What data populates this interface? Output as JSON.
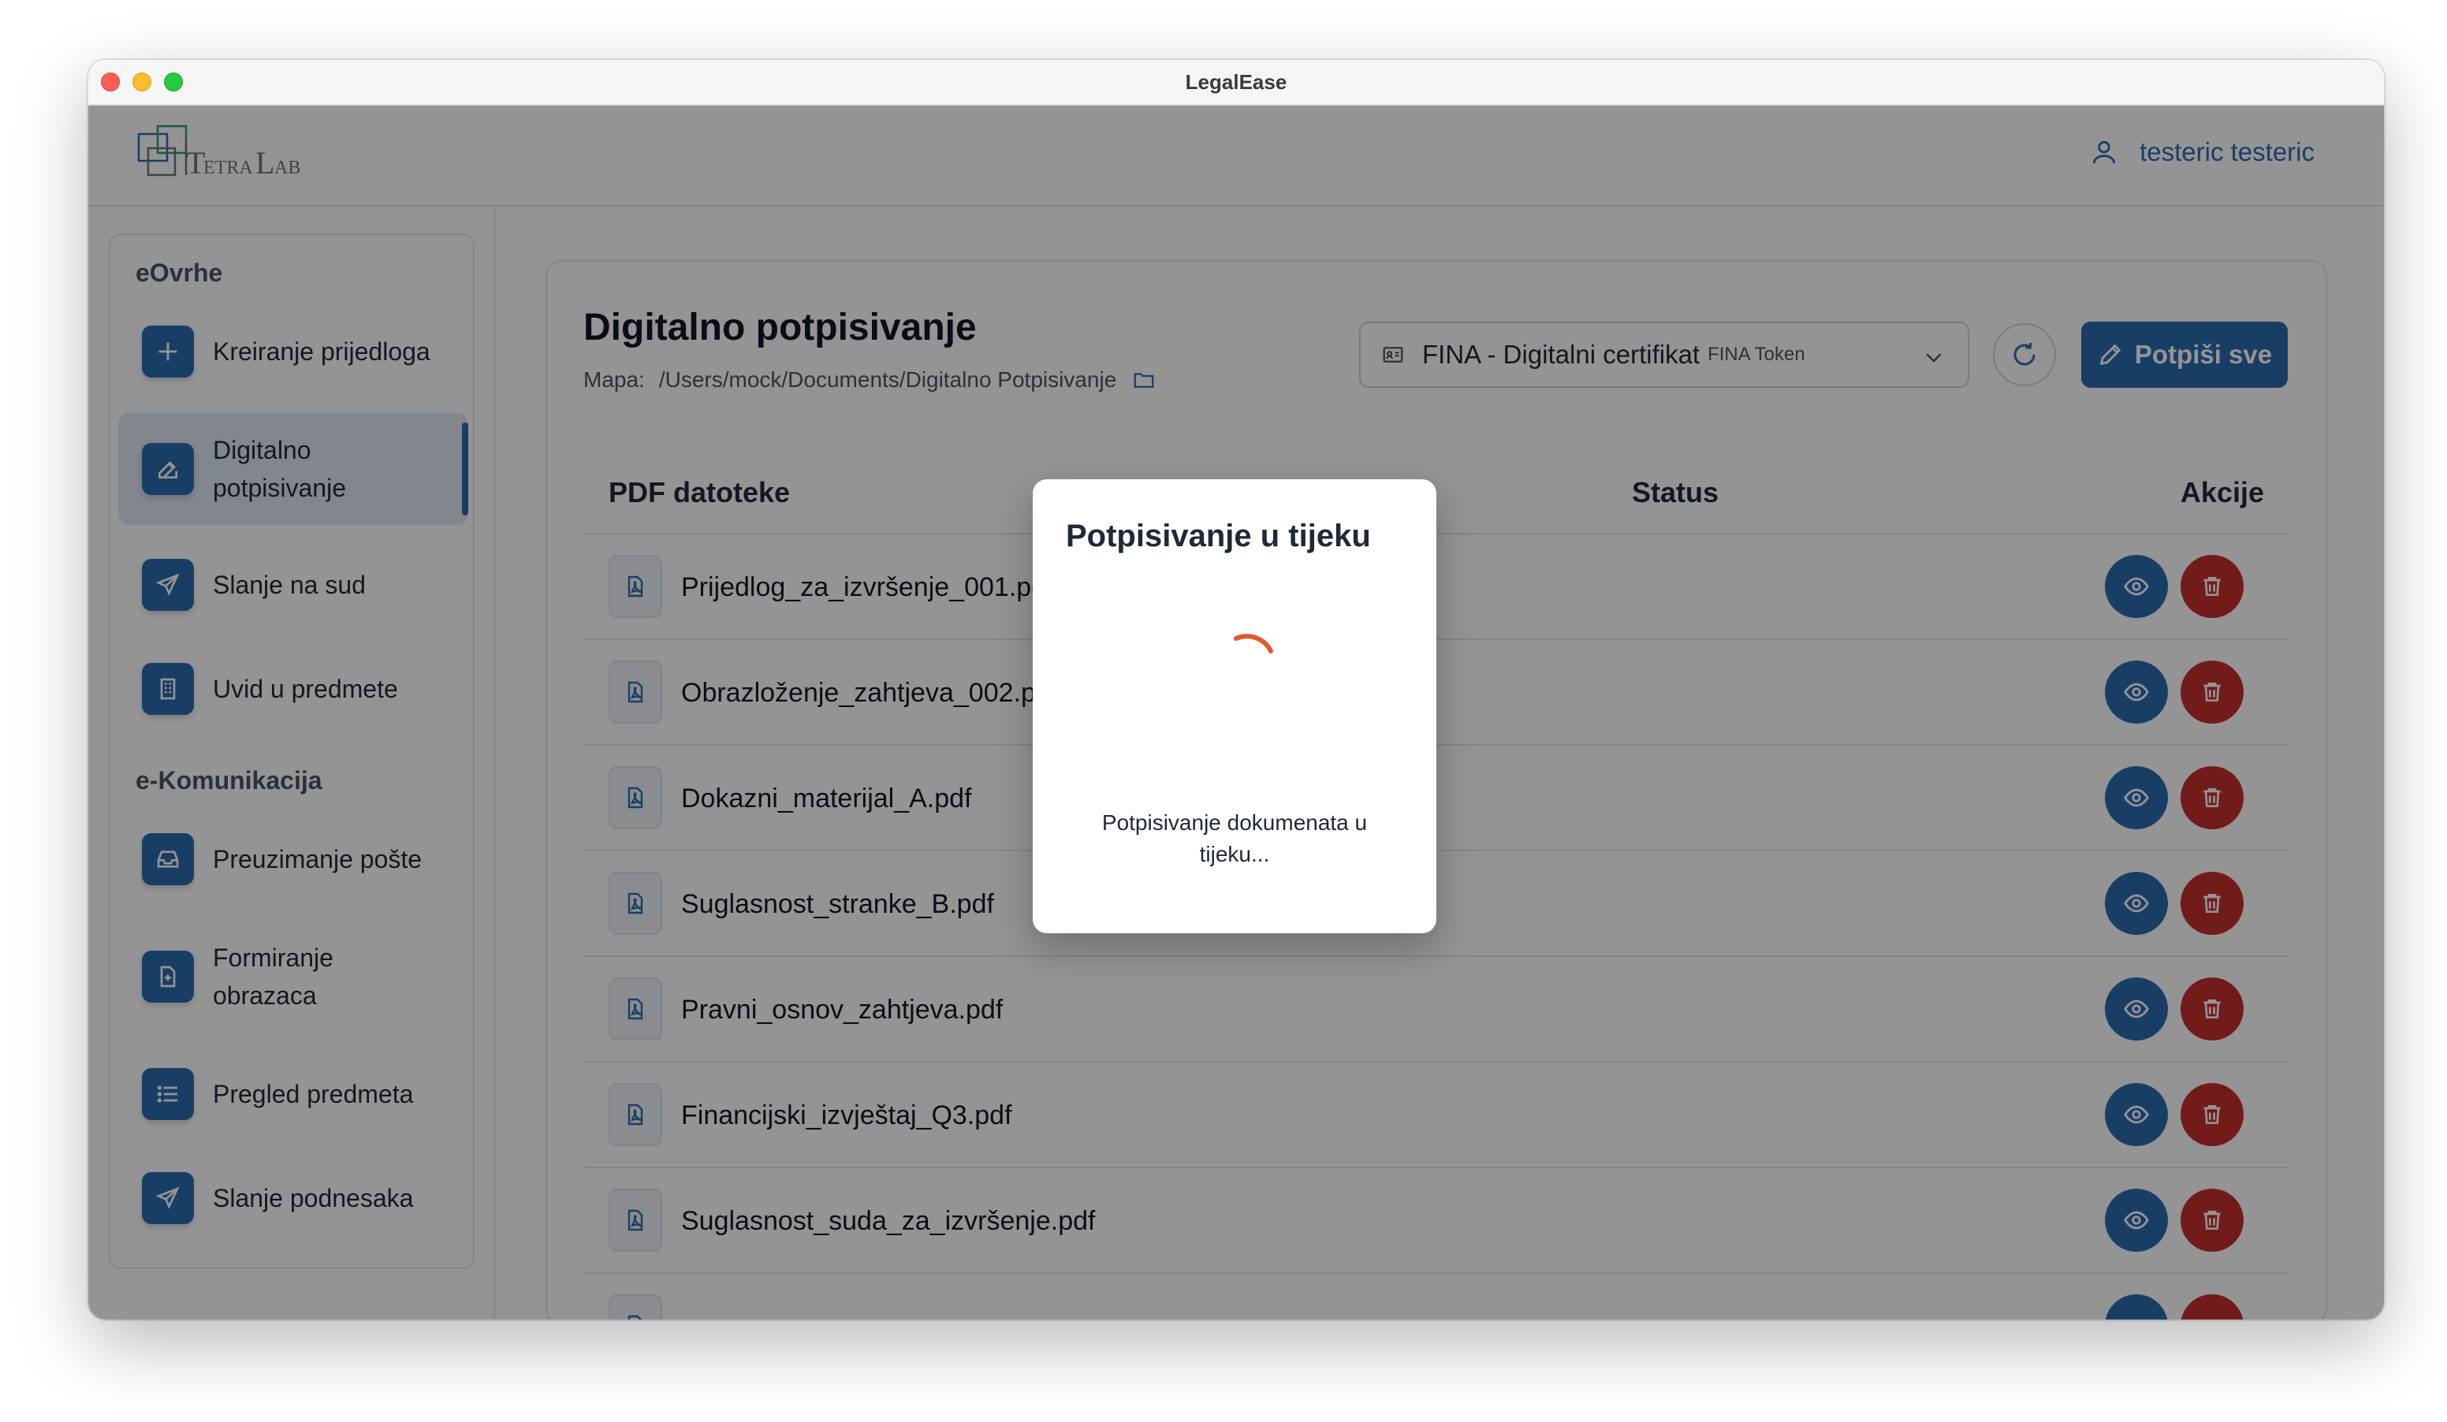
{
  "window": {
    "title": "LegalEase"
  },
  "header": {
    "logo_text": "TetraLab",
    "user_name": "testeric testeric"
  },
  "sidebar": {
    "sections": [
      {
        "title": "eOvrhe"
      },
      {
        "title": "e-Komunikacija"
      }
    ],
    "items": [
      {
        "label": "Kreiranje prijedloga",
        "icon": "plus-icon",
        "active": false
      },
      {
        "label": "Digitalno\npotpisivanje",
        "icon": "edit-icon",
        "active": true
      },
      {
        "label": "Slanje na sud",
        "icon": "send-icon",
        "active": false
      },
      {
        "label": "Uvid u predmete",
        "icon": "building-icon",
        "active": false
      },
      {
        "label": "Preuzimanje pošte",
        "icon": "inbox-icon",
        "active": false
      },
      {
        "label": "Formiranje\nobrazaca",
        "icon": "document-add-icon",
        "active": false
      },
      {
        "label": "Pregled predmeta",
        "icon": "list-icon",
        "active": false
      },
      {
        "label": "Slanje podnesaka",
        "icon": "send-icon",
        "active": false
      }
    ]
  },
  "main": {
    "title": "Digitalno potpisivanje",
    "path_label": "Mapa:",
    "path_value": "/Users/mock/Documents/Digitalno Potpisivanje",
    "certificate": {
      "name": "FINA - Digitalni certifikat",
      "type": "FINA Token"
    },
    "sign_all_label": "Potpiši sve",
    "table": {
      "headers": [
        "PDF datoteke",
        "Status",
        "Akcije"
      ],
      "rows": [
        {
          "file": "Prijedlog_za_izvršenje_001.pdf"
        },
        {
          "file": "Obrazloženje_zahtjeva_002.pdf"
        },
        {
          "file": "Dokazni_materijal_A.pdf"
        },
        {
          "file": "Suglasnost_stranke_B.pdf"
        },
        {
          "file": "Pravni_osnov_zahtjeva.pdf"
        },
        {
          "file": "Financijski_izvještaj_Q3.pdf"
        },
        {
          "file": "Suglasnost_suda_za_izvršenje.pdf"
        },
        {
          "file": ""
        }
      ]
    }
  },
  "modal": {
    "title": "Potpisivanje u tijeku",
    "message": "Potpisivanje dokumenata u tijeku..."
  },
  "colors": {
    "primary": "#2b6cb0",
    "danger": "#c53030",
    "spinner": "#e05a2b"
  }
}
